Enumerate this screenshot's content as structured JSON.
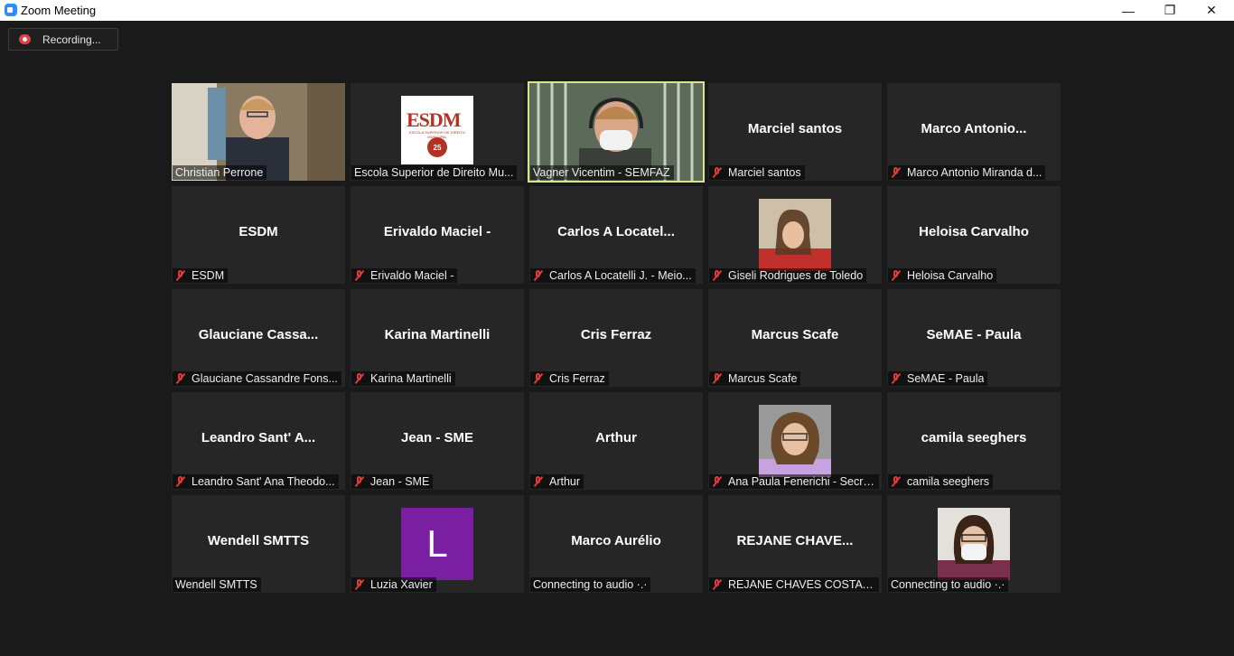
{
  "window": {
    "title": "Zoom Meeting",
    "min_glyph": "—",
    "max_glyph": "❐",
    "close_glyph": "✕"
  },
  "recording": {
    "label": "Recording..."
  },
  "participants": [
    {
      "display": "",
      "tag": "Christian Perrone",
      "muted": false,
      "visual": "video-christian"
    },
    {
      "display": "",
      "tag": "Escola Superior de Direito Mu...",
      "muted": false,
      "visual": "logo"
    },
    {
      "display": "",
      "tag": "Vagner Vicentim - SEMFAZ",
      "muted": false,
      "visual": "video-vagner",
      "active": true
    },
    {
      "display": "Marciel santos",
      "tag": "Marciel santos",
      "muted": true
    },
    {
      "display": "Marco  Antonio...",
      "tag": "Marco Antonio Miranda d...",
      "muted": true
    },
    {
      "display": "ESDM",
      "tag": "ESDM",
      "muted": true
    },
    {
      "display": "Erivaldo Maciel -",
      "tag": "Erivaldo Maciel -",
      "muted": true
    },
    {
      "display": "Carlos  A  Locatel...",
      "tag": "Carlos A Locatelli J. - Meio...",
      "muted": true
    },
    {
      "display": "",
      "tag": "Giseli Rodrigues de Toledo",
      "muted": true,
      "visual": "photo-giseli"
    },
    {
      "display": "Heloisa Carvalho",
      "tag": "Heloisa Carvalho",
      "muted": true
    },
    {
      "display": "Glauciane  Cassa...",
      "tag": "Glauciane Cassandre Fons...",
      "muted": true
    },
    {
      "display": "Karina Martinelli",
      "tag": "Karina Martinelli",
      "muted": true
    },
    {
      "display": "Cris Ferraz",
      "tag": "Cris Ferraz",
      "muted": true
    },
    {
      "display": "Marcus Scafe",
      "tag": "Marcus Scafe",
      "muted": true
    },
    {
      "display": "SeMAE - Paula",
      "tag": "SeMAE - Paula",
      "muted": true
    },
    {
      "display": "Leandro Sant' A...",
      "tag": "Leandro Sant' Ana Theodo...",
      "muted": true
    },
    {
      "display": "Jean - SME",
      "tag": "Jean - SME",
      "muted": true
    },
    {
      "display": "Arthur",
      "tag": "Arthur",
      "muted": true
    },
    {
      "display": "",
      "tag": "Ana Paula Fenerichi - Secre...",
      "muted": true,
      "visual": "photo-ana"
    },
    {
      "display": "camila seeghers",
      "tag": "camila seeghers",
      "muted": true
    },
    {
      "display": "Wendell SMTTS",
      "tag": "Wendell SMTTS",
      "muted": false
    },
    {
      "display": "",
      "tag": "Luzia Xavier",
      "muted": true,
      "visual": "letter",
      "letter": "L"
    },
    {
      "display": "Marco Aurélio",
      "tag": "Connecting to audio ·.·",
      "muted": false
    },
    {
      "display": "REJANE  CHAVE...",
      "tag": "REJANE CHAVES COSTA G...",
      "muted": true
    },
    {
      "display": "",
      "tag": "Connecting to audio ·.·",
      "muted": false,
      "visual": "photo-mask"
    }
  ],
  "logo": {
    "text": "ESDM",
    "subtitle": "ESCOLA SUPERIOR DE DIREITO MUNICIPAL",
    "seal": "25"
  },
  "colors": {
    "active_border": "#d6e68a",
    "muted_icon": "#e03b3b",
    "avatar_purple": "#7a1fa2"
  }
}
